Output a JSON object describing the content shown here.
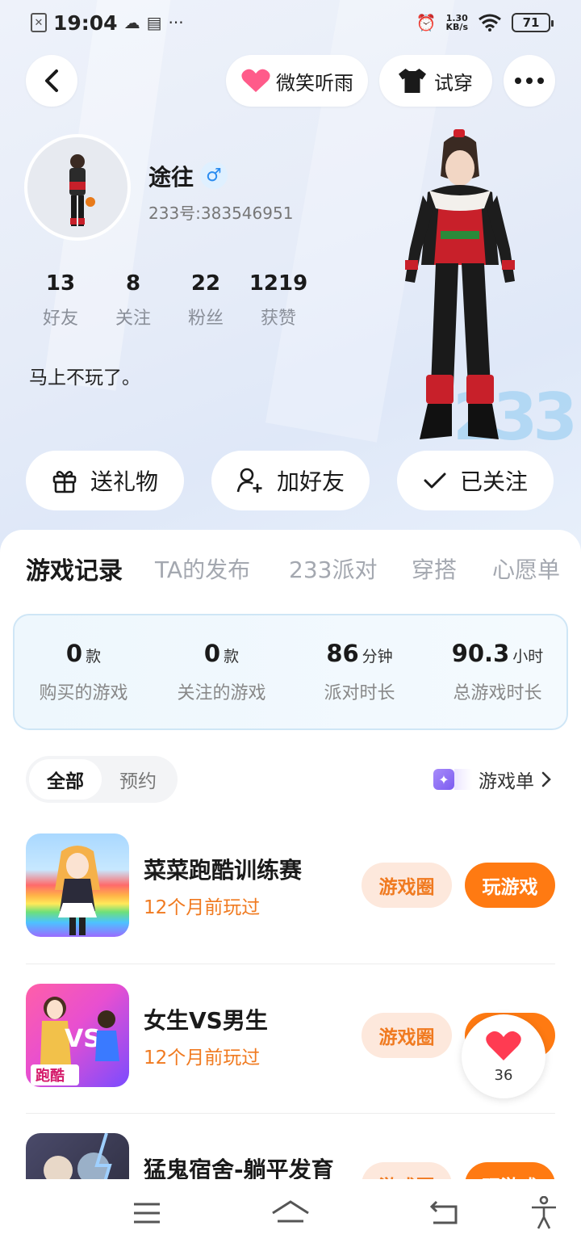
{
  "status_bar": {
    "time": "19:04",
    "net_speed_value": "1.30",
    "net_speed_unit": "KB/s",
    "battery": "71"
  },
  "header": {
    "friend_name": "微笑听雨",
    "try_on_label": "试穿"
  },
  "profile": {
    "username": "途往",
    "gender_symbol": "♂",
    "user_id": "233号:383546951",
    "bio": "马上不玩了。",
    "stats": [
      {
        "num": "13",
        "label": "好友"
      },
      {
        "num": "8",
        "label": "关注"
      },
      {
        "num": "22",
        "label": "粉丝"
      },
      {
        "num": "1219",
        "label": "获赞"
      }
    ]
  },
  "actions": {
    "gift": "送礼物",
    "add_friend": "加好友",
    "followed": "已关注"
  },
  "tabs": [
    "游戏记录",
    "TA的发布",
    "233派对",
    "穿搭",
    "心愿单"
  ],
  "summary": [
    {
      "value": "0",
      "unit": "款",
      "label": "购买的游戏"
    },
    {
      "value": "0",
      "unit": "款",
      "label": "关注的游戏"
    },
    {
      "value": "86",
      "unit": "分钟",
      "label": "派对时长"
    },
    {
      "value": "90.3",
      "unit": "小时",
      "label": "总游戏时长"
    }
  ],
  "filter": {
    "all": "全部",
    "reserve": "预约"
  },
  "game_list_link": "游戏单",
  "games": [
    {
      "name": "菜菜跑酷训练赛",
      "played": "12个月前玩过",
      "circle": "游戏圈",
      "play": "玩游戏"
    },
    {
      "name": "女生VS男生",
      "played": "12个月前玩过",
      "circle": "游戏圈",
      "play": "玩游戏"
    },
    {
      "name": "猛鬼宿舍-躺平发育",
      "played": "",
      "circle": "游戏圈",
      "play": "玩游戏"
    }
  ],
  "likes": {
    "count": "36"
  },
  "thumb2_text": "跑酷"
}
